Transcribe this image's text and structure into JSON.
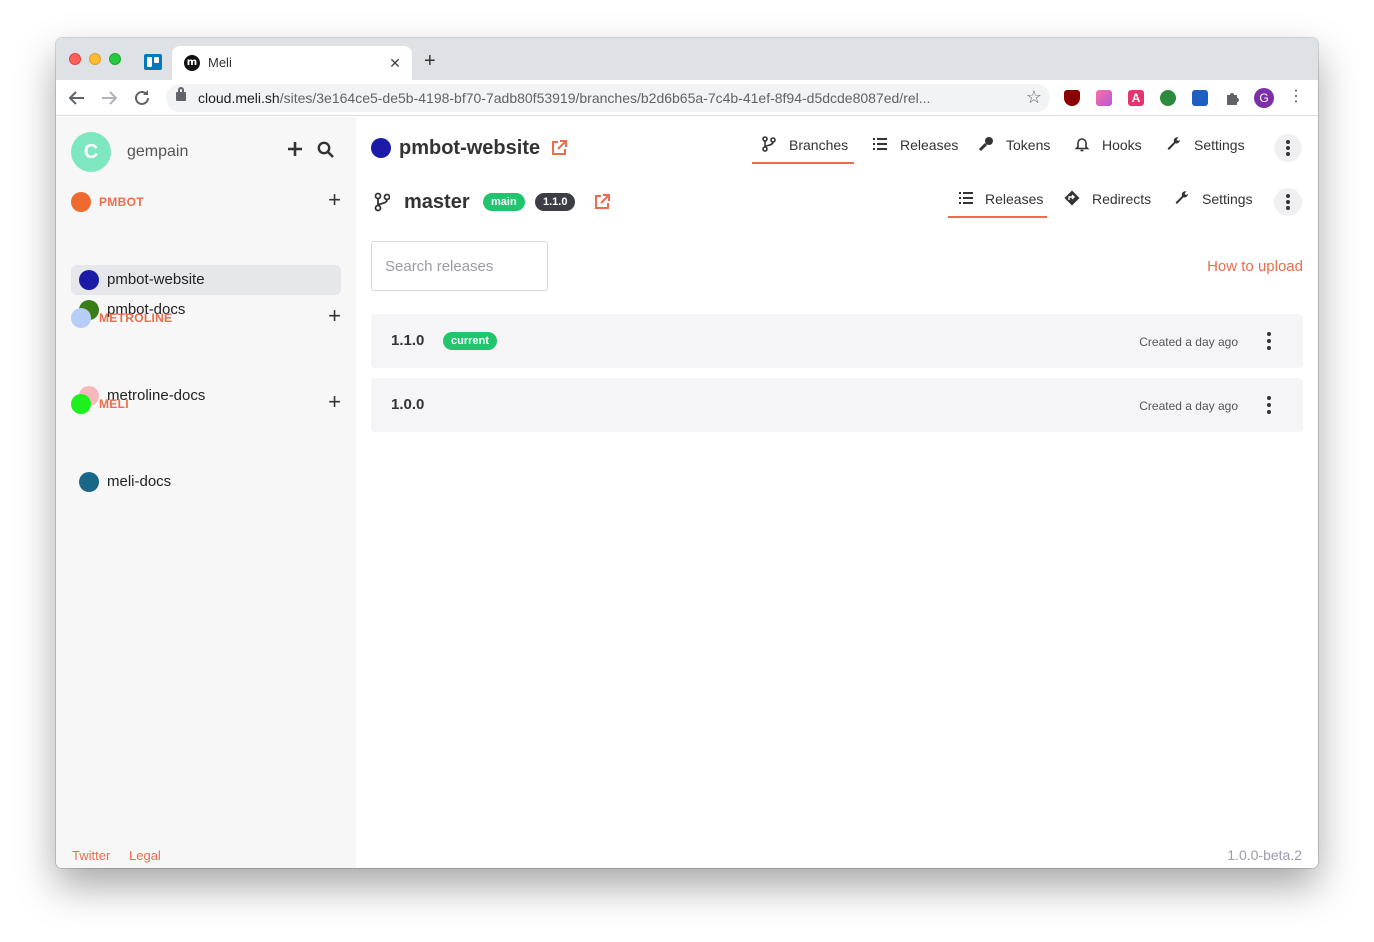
{
  "browser": {
    "tab_title": "Meli",
    "tab_favicon_letter": "m",
    "url_host": "cloud.meli.sh",
    "url_path": "/sites/3e164ce5-de5b-4198-bf70-7adb80f53919/branches/b2d6b65a-7c4b-41ef-8f94-d5dcde8087ed/rel...",
    "profile_initial": "G"
  },
  "sidebar": {
    "org_initial": "C",
    "org_name": "gempain",
    "groups": [
      {
        "label": "PMBOT",
        "color": "#ee6a2f",
        "sites": [
          {
            "label": "pmbot-website",
            "color": "#1b1ba8",
            "active": true
          },
          {
            "label": "pmbot-docs",
            "color": "#3a7d16",
            "active": false
          }
        ]
      },
      {
        "label": "METROLINE",
        "color": "#b8cdf5",
        "sites": [
          {
            "label": "metroline-docs",
            "color": "#f7b8bc",
            "active": false
          }
        ]
      },
      {
        "label": "MELI",
        "color": "#1ef01e",
        "sites": [
          {
            "label": "meli-docs",
            "color": "#1a6688",
            "active": false
          }
        ]
      }
    ],
    "footer": {
      "twitter": "Twitter",
      "legal": "Legal"
    }
  },
  "site_header": {
    "title": "pmbot-website",
    "tabs": [
      {
        "label": "Branches",
        "icon": "branch-icon"
      },
      {
        "label": "Releases",
        "icon": "list-icon"
      },
      {
        "label": "Tokens",
        "icon": "key-icon"
      },
      {
        "label": "Hooks",
        "icon": "bell-icon"
      },
      {
        "label": "Settings",
        "icon": "wrench-icon"
      }
    ]
  },
  "branch_header": {
    "name": "master",
    "badge_main": "main",
    "badge_release": "1.1.0",
    "tabs": [
      {
        "label": "Releases",
        "icon": "list-icon"
      },
      {
        "label": "Redirects",
        "icon": "redirect-icon"
      },
      {
        "label": "Settings",
        "icon": "wrench-icon"
      }
    ]
  },
  "releases": {
    "search_placeholder": "Search releases",
    "how_to_upload": "How to upload",
    "items": [
      {
        "version": "1.1.0",
        "badge": "current",
        "created": "Created a day ago"
      },
      {
        "version": "1.0.0",
        "badge": "",
        "created": "Created a day ago"
      }
    ]
  },
  "app_version": "1.0.0-beta.2",
  "colors": {
    "accent": "#ee6c4d",
    "badge_green": "#20c56e",
    "badge_dark": "#3d3d45"
  }
}
